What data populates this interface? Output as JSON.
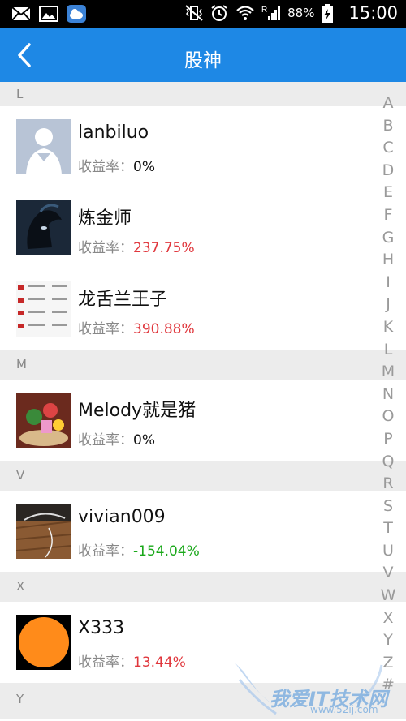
{
  "status": {
    "battery": "88%",
    "time": "15:00",
    "network": "R"
  },
  "app": {
    "title": "股神"
  },
  "groups": [
    {
      "letter": "L",
      "items": [
        {
          "name": "lanbiluo",
          "yield_label": "收益率：",
          "yield_value": "0%",
          "color": "#111111",
          "avatar": "superman-avatar"
        },
        {
          "name": "炼金师",
          "yield_label": "收益率：",
          "yield_value": "237.75%",
          "color": "#e0363c",
          "avatar": "spartan-helmet-avatar"
        },
        {
          "name": "龙舌兰王子",
          "yield_label": "收益率：",
          "yield_value": "390.88%",
          "color": "#e0363c",
          "avatar": "stock-list-avatar"
        }
      ]
    },
    {
      "letter": "M",
      "items": [
        {
          "name": "Melody就是猪",
          "yield_label": "收益率：",
          "yield_value": "0%",
          "color": "#111111",
          "avatar": "toys-avatar"
        }
      ]
    },
    {
      "letter": "V",
      "items": [
        {
          "name": "vivian009",
          "yield_label": "收益率：",
          "yield_value": "-154.04%",
          "color": "#1aa81a",
          "avatar": "wood-desk-avatar"
        }
      ]
    },
    {
      "letter": "X",
      "items": [
        {
          "name": "X333",
          "yield_label": "收益率：",
          "yield_value": "13.44%",
          "color": "#e0363c",
          "avatar": "orange-circle-avatar"
        }
      ]
    },
    {
      "letter": "Y",
      "items": []
    }
  ],
  "index_letters": [
    "A",
    "B",
    "C",
    "D",
    "E",
    "F",
    "G",
    "H",
    "I",
    "J",
    "K",
    "L",
    "M",
    "N",
    "O",
    "P",
    "Q",
    "R",
    "S",
    "T",
    "U",
    "V",
    "W",
    "X",
    "Y",
    "Z",
    "#"
  ],
  "watermark": {
    "text": "我爱IT技术网",
    "sub": "www.52ij.com"
  }
}
